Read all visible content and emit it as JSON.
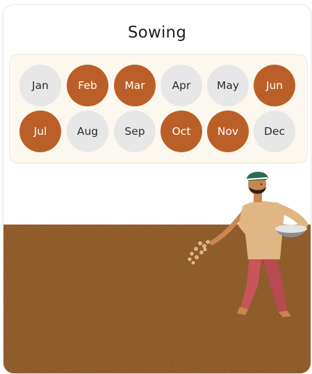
{
  "card": {
    "title": "Sowing"
  },
  "calendar": {
    "months": [
      {
        "label": "Jan",
        "active": false
      },
      {
        "label": "Feb",
        "active": true
      },
      {
        "label": "Mar",
        "active": true
      },
      {
        "label": "Apr",
        "active": false
      },
      {
        "label": "May",
        "active": false
      },
      {
        "label": "Jun",
        "active": true
      },
      {
        "label": "Jul",
        "active": true
      },
      {
        "label": "Aug",
        "active": false
      },
      {
        "label": "Sep",
        "active": false
      },
      {
        "label": "Oct",
        "active": true
      },
      {
        "label": "Nov",
        "active": true
      },
      {
        "label": "Dec",
        "active": false
      }
    ]
  },
  "colors": {
    "active": "#bb5f28",
    "inactive": "#e7e7e7",
    "soil": "#7a4418",
    "panel": "#fdf8ef"
  },
  "illustration": {
    "subject": "farmer-sowing-seeds-icon"
  }
}
